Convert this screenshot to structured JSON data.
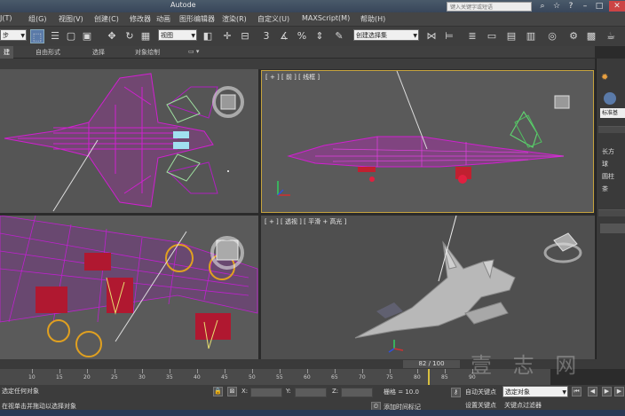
{
  "titlebar": {
    "app_title": "Autode",
    "help_search_placeholder": "键入关键字或短语"
  },
  "menus": [
    "J(T)",
    "组(G)",
    "视图(V)",
    "创建(C)",
    "修改器",
    "动画",
    "图形编辑器",
    "渲染(R)",
    "自定义(U)",
    "MAXScript(M)",
    "帮助(H)"
  ],
  "toolbar": {
    "select_filter": "步",
    "view_dropdown": "视图",
    "selection_set": "创建选择集"
  },
  "ribbon_tabs": [
    "建",
    "自由形式",
    "选择",
    "对象绘制"
  ],
  "viewports": {
    "front_label": "[ + ] [ 前 ] [ 线框 ]",
    "persp_label": "[ + ] [ 透视 ] [ 平滑 + 高光 ]"
  },
  "command_panel": {
    "dropdown": "标准基",
    "labels": [
      "长方",
      "球",
      "圆柱",
      "茶"
    ]
  },
  "timeline": {
    "frame_display": "82 / 100",
    "current_frame": 82,
    "total_frames": 100,
    "ticks": [
      "10",
      "15",
      "20",
      "25",
      "30",
      "35",
      "40",
      "45",
      "50",
      "55",
      "60",
      "65",
      "70",
      "75",
      "80",
      "85",
      "90"
    ]
  },
  "status": {
    "line1": "选定任何对象",
    "line2": "在视单击并拖动以选择对象",
    "x_label": "X:",
    "y_label": "Y:",
    "z_label": "Z:",
    "grid": "栅格 = 10.0",
    "add_time_tag": "添加时间标记",
    "auto_key": "自动关键点",
    "set_key": "设置关键点",
    "selected_object": "选定对象",
    "key_filter": "关键点过滤器"
  },
  "colors": {
    "wireframe": "#d020d0",
    "active_border": "#c6a33e"
  }
}
